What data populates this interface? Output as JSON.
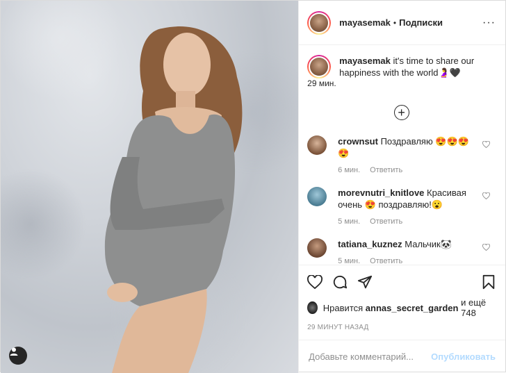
{
  "header": {
    "username": "mayasemak",
    "separator": "•",
    "follow_label": "Подписки",
    "more_label": "···"
  },
  "caption": {
    "username": "mayasemak",
    "text": "it's time to share our happiness with the world🤰🖤",
    "time": "29 мин."
  },
  "load_more_label": "+",
  "comments": [
    {
      "username": "crownsut",
      "text": "Поздравляю 😍😍😍😍",
      "time": "6 мин.",
      "reply": "Ответить"
    },
    {
      "username": "morevnutri_knitlove",
      "text": "Красивая очень 😍 поздравляю!😮",
      "time": "5 мин.",
      "reply": "Ответить"
    },
    {
      "username": "tatiana_kuznez",
      "text": "Мальчик🐼",
      "time": "5 мин.",
      "reply": "Ответить"
    }
  ],
  "likes": {
    "prefix": "Нравится",
    "user": "annas_secret_garden",
    "suffix": "и ещё 748"
  },
  "posted_ago": "29 МИНУТ НАЗАД",
  "add_comment": {
    "placeholder": "Добавьте комментарий...",
    "publish_label": "Опубликовать"
  },
  "colors": {
    "story_ring": "#d6249f",
    "publish_disabled": "#b3dbff",
    "muted_text": "#8e8e8e"
  }
}
